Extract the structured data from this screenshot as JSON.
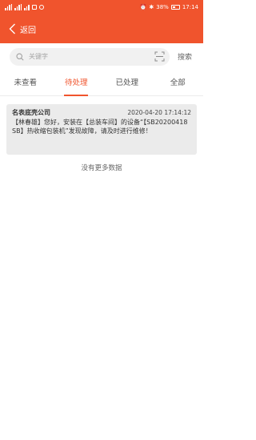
{
  "statusbar": {
    "battery_text": "38%",
    "time": "17:14"
  },
  "navbar": {
    "back_label": "返回"
  },
  "search": {
    "placeholder": "关键字",
    "button_label": "搜索"
  },
  "tabs": [
    {
      "label": "未查看",
      "active": false
    },
    {
      "label": "待处理",
      "active": true
    },
    {
      "label": "已处理",
      "active": false
    },
    {
      "label": "全部",
      "active": false
    }
  ],
  "messages": [
    {
      "company": "名表底壳公司",
      "datetime": "2020-04-20 17:14:12",
      "text": "【林春雄】您好，安装在【总装车间】的设备“【SB20200418SB】热收缩包装机”发现故障，请及时进行维修！"
    }
  ],
  "footer": {
    "no_more_text": "没有更多数据"
  },
  "colors": {
    "accent": "#f0542d",
    "card_bg": "#ebebeb"
  }
}
